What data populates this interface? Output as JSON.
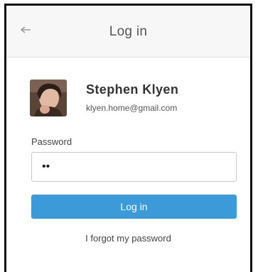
{
  "header": {
    "title": "Log in",
    "back_icon": "back-arrow-icon"
  },
  "user": {
    "name": "Stephen Klyen",
    "email": "klyen.home@gmail.com",
    "avatar": "user-avatar-photo"
  },
  "password": {
    "label": "Password",
    "value": "••"
  },
  "actions": {
    "login_label": "Log in",
    "forgot_label": "I forgot my password"
  },
  "colors": {
    "accent": "#3d9ad8",
    "header_bg": "#f7f7f7"
  }
}
